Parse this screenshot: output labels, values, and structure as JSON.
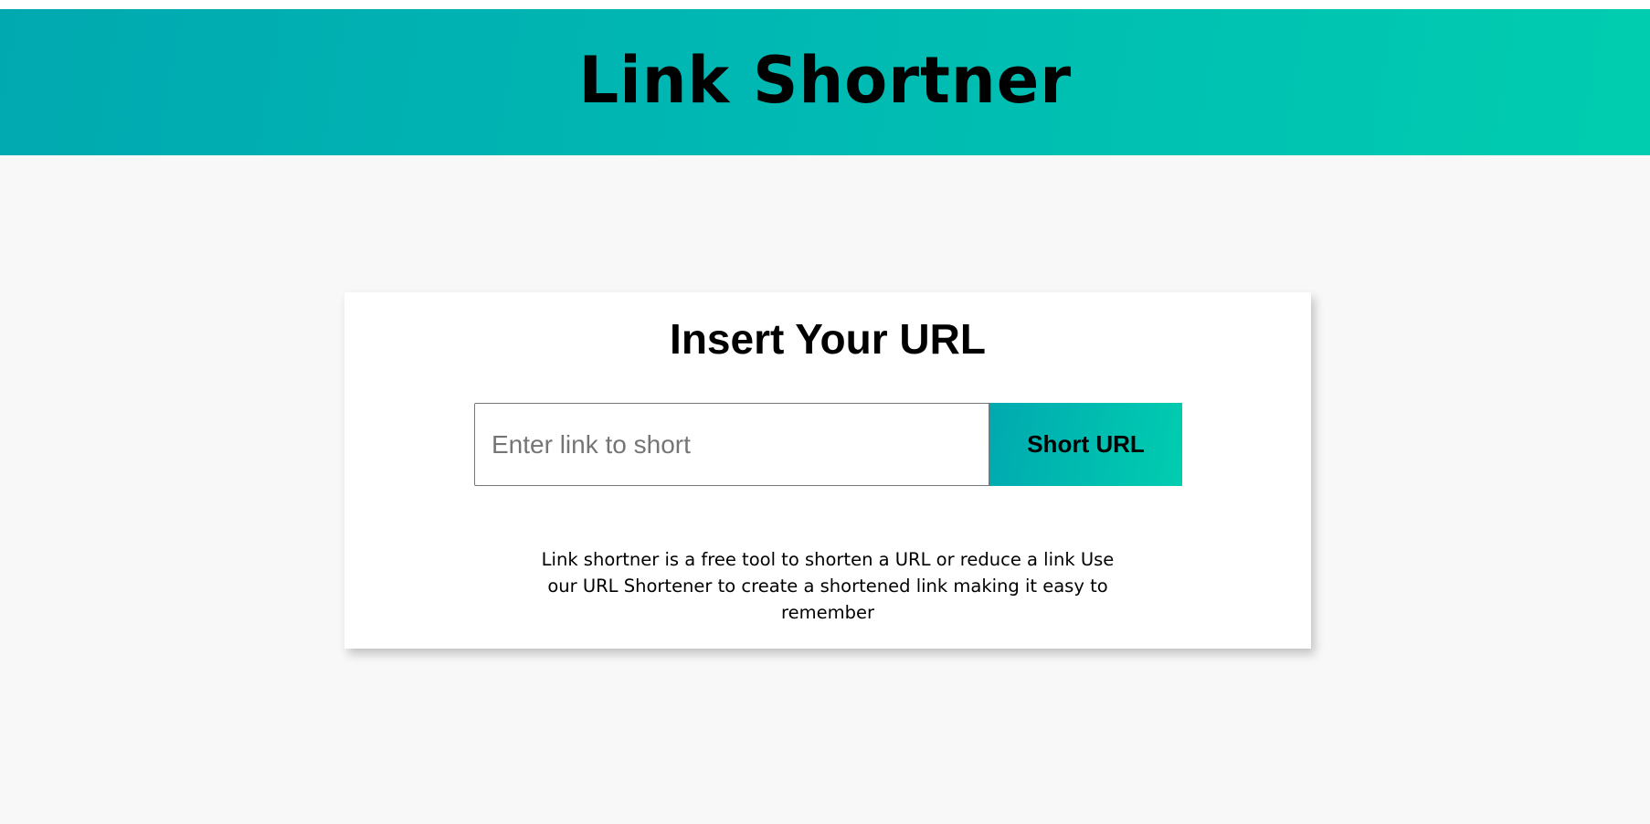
{
  "header": {
    "title": "Link Shortner"
  },
  "card": {
    "title": "Insert Your URL",
    "input": {
      "placeholder": "Enter link to short",
      "value": ""
    },
    "button_label": "Short URL",
    "description": "Link shortner is a free tool to shorten a URL or reduce a link Use our URL Shortener to create a shortened link making it easy to remember"
  },
  "colors": {
    "gradient_start": "#00a9b0",
    "gradient_end": "#00cdb0",
    "page_background": "#f8f8f8",
    "card_background": "#ffffff"
  }
}
